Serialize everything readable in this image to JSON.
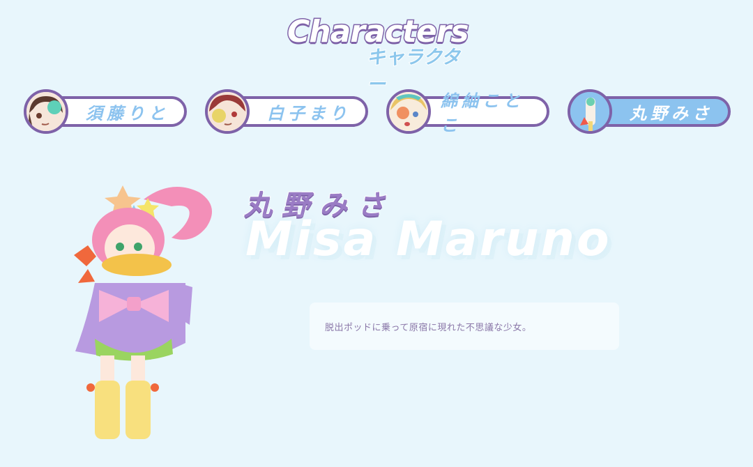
{
  "header": {
    "title": "Characters",
    "subtitle": "キャラクター"
  },
  "tabs": [
    {
      "label": "須藤りと",
      "icon": "character-avatar-rito",
      "active": false
    },
    {
      "label": "白子まり",
      "icon": "character-avatar-mari",
      "active": false
    },
    {
      "label": "綿紬ことこ",
      "icon": "character-avatar-kotoko",
      "active": false
    },
    {
      "label": "丸野みさ",
      "icon": "character-avatar-misa",
      "active": true
    }
  ],
  "detail": {
    "name_jp": "丸野みさ",
    "name_en": "Misa Maruno",
    "description": "脱出ポッドに乗って原宿に現れた不思議な少女。"
  },
  "colors": {
    "background": "#e8f6fc",
    "accent_purple": "#7e62a8",
    "accent_blue": "#8cc3ef"
  }
}
